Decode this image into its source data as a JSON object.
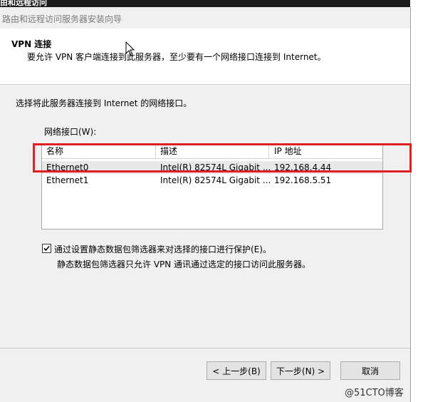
{
  "window": {
    "title_partial": "由和远程访问",
    "wizard_title": "路由和远程访问服务器安装向导"
  },
  "header": {
    "title": "VPN 连接",
    "subtitle": "要允许 VPN 客户端连接到此服务器，至少要有一个网络接口连接到 Internet。"
  },
  "body": {
    "prompt": "选择将此服务器连接到 Internet 的网络接口。",
    "list_label": "网络接口(W):",
    "columns": [
      "名称",
      "描述",
      "IP 地址"
    ],
    "rows": [
      {
        "name": "Ethernet0",
        "description": "Intel(R) 82574L Gigabit ...",
        "ip": "192.168.4.44",
        "selected": true
      },
      {
        "name": "Ethernet1",
        "description": "Intel(R) 82574L Gigabit ...",
        "ip": "192.168.5.51",
        "selected": false
      }
    ],
    "checkbox_label": "通过设置静态数据包筛选器来对选择的接口进行保护(E)。",
    "checkbox_checked": true,
    "checkbox_note": "静态数据包筛选器只允许 VPN 通讯通过选定的接口访问此服务器。"
  },
  "buttons": {
    "back": "< 上一步(B)",
    "next": "下一步(N) >",
    "cancel": "取消"
  },
  "watermark": "@51CTO博客",
  "colors": {
    "highlight": "#e02020"
  }
}
